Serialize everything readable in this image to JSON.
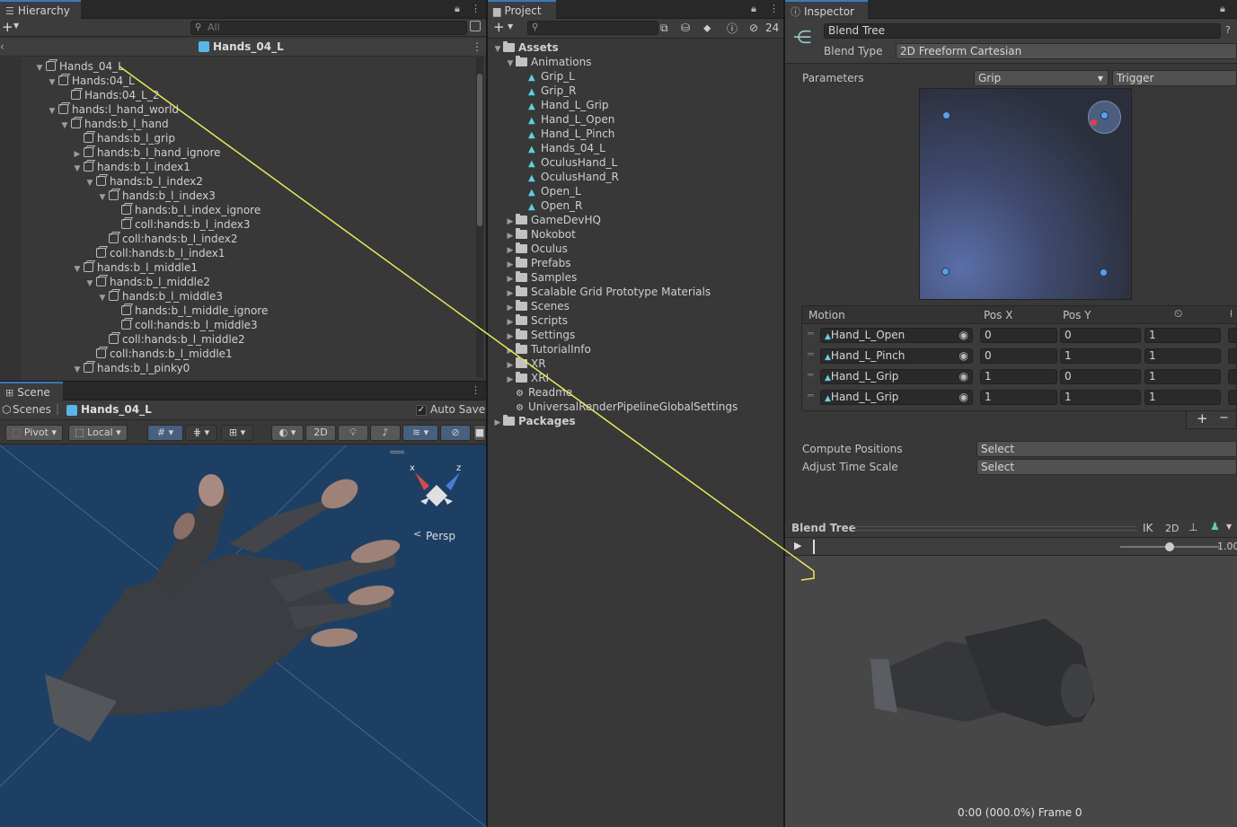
{
  "hierarchy": {
    "tab": "Hierarchy",
    "search_placeholder": "All",
    "scene_name": "Hands_04_L",
    "items": [
      {
        "label": "Hands_04_L",
        "expand": "open"
      },
      {
        "label": "Hands:04_L",
        "expand": "open"
      },
      {
        "label": "Hands:04_L_2",
        "expand": "none"
      },
      {
        "label": "hands:l_hand_world",
        "expand": "open"
      },
      {
        "label": "hands:b_l_hand",
        "expand": "open"
      },
      {
        "label": "hands:b_l_grip",
        "expand": "none"
      },
      {
        "label": "hands:b_l_hand_ignore",
        "expand": "closed"
      },
      {
        "label": "hands:b_l_index1",
        "expand": "open"
      },
      {
        "label": "hands:b_l_index2",
        "expand": "open"
      },
      {
        "label": "hands:b_l_index3",
        "expand": "open"
      },
      {
        "label": "hands:b_l_index_ignore",
        "expand": "none"
      },
      {
        "label": "coll:hands:b_l_index3",
        "expand": "none"
      },
      {
        "label": "coll:hands:b_l_index2",
        "expand": "none"
      },
      {
        "label": "coll:hands:b_l_index1",
        "expand": "none"
      },
      {
        "label": "hands:b_l_middle1",
        "expand": "open"
      },
      {
        "label": "hands:b_l_middle2",
        "expand": "open"
      },
      {
        "label": "hands:b_l_middle3",
        "expand": "open"
      },
      {
        "label": "hands:b_l_middle_ignore",
        "expand": "none"
      },
      {
        "label": "coll:hands:b_l_middle3",
        "expand": "none"
      },
      {
        "label": "coll:hands:b_l_middle2",
        "expand": "none"
      },
      {
        "label": "coll:hands:b_l_middle1",
        "expand": "none"
      },
      {
        "label": "hands:b_l_pinky0",
        "expand": "open"
      }
    ]
  },
  "scene": {
    "tab": "Scene",
    "breadcrumb_root": "Scenes",
    "breadcrumb_item": "Hands_04_L",
    "auto_save": "Auto Save",
    "pivot": "Pivot",
    "local": "Local",
    "mode_2d": "2D",
    "gizmo_x": "x",
    "gizmo_z": "z",
    "persp": "Persp"
  },
  "project": {
    "tab": "Project",
    "hidden_count": "24",
    "items": [
      {
        "label": "Assets",
        "type": "folder",
        "expand": "open",
        "bold": true
      },
      {
        "label": "Animations",
        "type": "folder",
        "expand": "open"
      },
      {
        "label": "Grip_L",
        "type": "anim"
      },
      {
        "label": "Grip_R",
        "type": "anim"
      },
      {
        "label": "Hand_L_Grip",
        "type": "anim"
      },
      {
        "label": "Hand_L_Open",
        "type": "anim"
      },
      {
        "label": "Hand_L_Pinch",
        "type": "anim"
      },
      {
        "label": "Hands_04_L",
        "type": "anim"
      },
      {
        "label": "OculusHand_L",
        "type": "anim"
      },
      {
        "label": "OculusHand_R",
        "type": "anim"
      },
      {
        "label": "Open_L",
        "type": "anim"
      },
      {
        "label": "Open_R",
        "type": "anim"
      },
      {
        "label": "GameDevHQ",
        "type": "folder",
        "expand": "closed"
      },
      {
        "label": "Nokobot",
        "type": "folder",
        "expand": "closed"
      },
      {
        "label": "Oculus",
        "type": "folder",
        "expand": "closed"
      },
      {
        "label": "Prefabs",
        "type": "folder",
        "expand": "closed"
      },
      {
        "label": "Samples",
        "type": "folder",
        "expand": "closed"
      },
      {
        "label": "Scalable Grid Prototype Materials",
        "type": "folder",
        "expand": "closed"
      },
      {
        "label": "Scenes",
        "type": "folder",
        "expand": "closed"
      },
      {
        "label": "Scripts",
        "type": "folder",
        "expand": "closed"
      },
      {
        "label": "Settings",
        "type": "folder",
        "expand": "closed"
      },
      {
        "label": "TutorialInfo",
        "type": "folder",
        "expand": "closed"
      },
      {
        "label": "XR",
        "type": "folder",
        "expand": "closed"
      },
      {
        "label": "XRI",
        "type": "folder",
        "expand": "closed"
      },
      {
        "label": "Readme",
        "type": "asset"
      },
      {
        "label": "UniversalRenderPipelineGlobalSettings",
        "type": "asset"
      },
      {
        "label": "Packages",
        "type": "folder",
        "expand": "closed",
        "bold": true
      }
    ]
  },
  "inspector": {
    "tab": "Inspector",
    "name": "Blend Tree",
    "blend_type_label": "Blend Type",
    "blend_type_value": "2D Freeform Cartesian",
    "parameters_label": "Parameters",
    "param_x": "Grip",
    "param_y": "Trigger",
    "motion_header": "Motion",
    "posx_header": "Pos X",
    "posy_header": "Pos Y",
    "motions": [
      {
        "name": "Hand_L_Open",
        "x": "0",
        "y": "0",
        "speed": "1"
      },
      {
        "name": "Hand_L_Pinch",
        "x": "0",
        "y": "1",
        "speed": "1"
      },
      {
        "name": "Hand_L_Grip",
        "x": "1",
        "y": "0",
        "speed": "1"
      },
      {
        "name": "Hand_L_Grip",
        "x": "1",
        "y": "1",
        "speed": "1"
      }
    ],
    "add": "+",
    "remove": "−",
    "compute_label": "Compute Positions",
    "compute_value": "Select",
    "adjust_label": "Adjust Time Scale",
    "adjust_value": "Select"
  },
  "preview": {
    "title": "Blend Tree",
    "ik": "IK",
    "mode_2d": "2D",
    "speed": "1.00",
    "status": "0:00 (000.0%) Frame 0"
  }
}
